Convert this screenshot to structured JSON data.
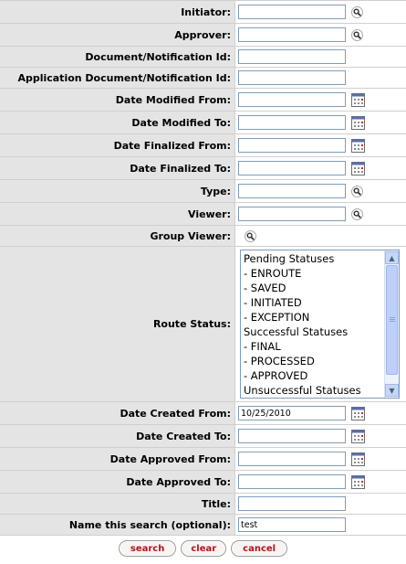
{
  "fields": {
    "initiator": {
      "label": "Initiator:",
      "value": ""
    },
    "approver": {
      "label": "Approver:",
      "value": ""
    },
    "doc_id": {
      "label": "Document/Notification Id:",
      "value": ""
    },
    "app_doc_id": {
      "label": "Application Document/Notification Id:",
      "value": ""
    },
    "date_modified_from": {
      "label": "Date Modified From:",
      "value": ""
    },
    "date_modified_to": {
      "label": "Date Modified To:",
      "value": ""
    },
    "date_finalized_from": {
      "label": "Date Finalized From:",
      "value": ""
    },
    "date_finalized_to": {
      "label": "Date Finalized To:",
      "value": ""
    },
    "type": {
      "label": "Type:",
      "value": ""
    },
    "viewer": {
      "label": "Viewer:",
      "value": ""
    },
    "group_viewer": {
      "label": "Group Viewer:"
    },
    "route_status": {
      "label": "Route Status:",
      "options": [
        "Pending Statuses",
        "- ENROUTE",
        "- SAVED",
        "- INITIATED",
        "- EXCEPTION",
        "Successful Statuses",
        "- FINAL",
        "- PROCESSED",
        "- APPROVED",
        "Unsuccessful Statuses"
      ]
    },
    "date_created_from": {
      "label": "Date Created From:",
      "value": "10/25/2010"
    },
    "date_created_to": {
      "label": "Date Created To:",
      "value": ""
    },
    "date_approved_from": {
      "label": "Date Approved From:",
      "value": ""
    },
    "date_approved_to": {
      "label": "Date Approved To:",
      "value": ""
    },
    "title": {
      "label": "Title:",
      "value": ""
    },
    "search_name": {
      "label": "Name this search (optional):",
      "value": "test"
    }
  },
  "buttons": {
    "search": "search",
    "clear": "clear",
    "cancel": "cancel"
  },
  "icons": {
    "lookup": "magnifier-icon",
    "calendar": "calendar-icon"
  },
  "colors": {
    "label_bg": "#e4e4e4",
    "button_text": "#b1151b",
    "input_border": "#7f9db9"
  }
}
